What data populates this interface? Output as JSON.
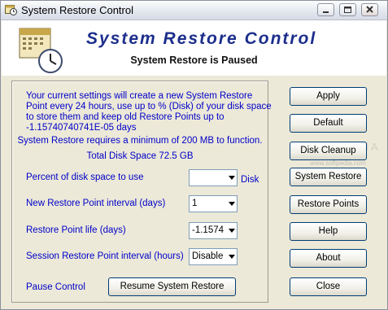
{
  "window": {
    "title": "System Restore Control"
  },
  "header": {
    "brand_title": "System Restore Control",
    "status": "System Restore is Paused"
  },
  "info": {
    "settings_text": "Your current settings will create a new System Restore Point every 24 hours, use up to % (Disk) of your disk space to store them and keep old Restore Points up to -1.15740740741E-05 days",
    "min_requirement": "System Restore requires a minimum of 200 MB to function.",
    "total_disk": "Total Disk Space 72.5 GB"
  },
  "settings": {
    "disk_percent": {
      "label": "Percent of disk space to use",
      "value": "",
      "suffix": "Disk"
    },
    "interval": {
      "label": "New Restore Point interval (days)",
      "value": "1"
    },
    "life": {
      "label": "Restore Point life (days)",
      "value": "-1.1574"
    },
    "session": {
      "label": "Session Restore Point interval (hours)",
      "value": "Disable"
    }
  },
  "pause": {
    "label": "Pause Control",
    "button": "Resume System Restore"
  },
  "buttons": {
    "apply": "Apply",
    "default": "Default",
    "disk_cleanup": "Disk Cleanup",
    "system_restore": "System Restore",
    "restore_points": "Restore Points",
    "help": "Help",
    "about": "About",
    "close": "Close"
  },
  "watermark": {
    "main": "SOFTPEDIA",
    "sub": "www.softpedia.com"
  },
  "colors": {
    "label_blue": "#0000c8",
    "brand_navy": "#1c2e8c",
    "window_bg": "#ece9d8"
  },
  "icons": {
    "app": "calendar-clock-icon"
  }
}
